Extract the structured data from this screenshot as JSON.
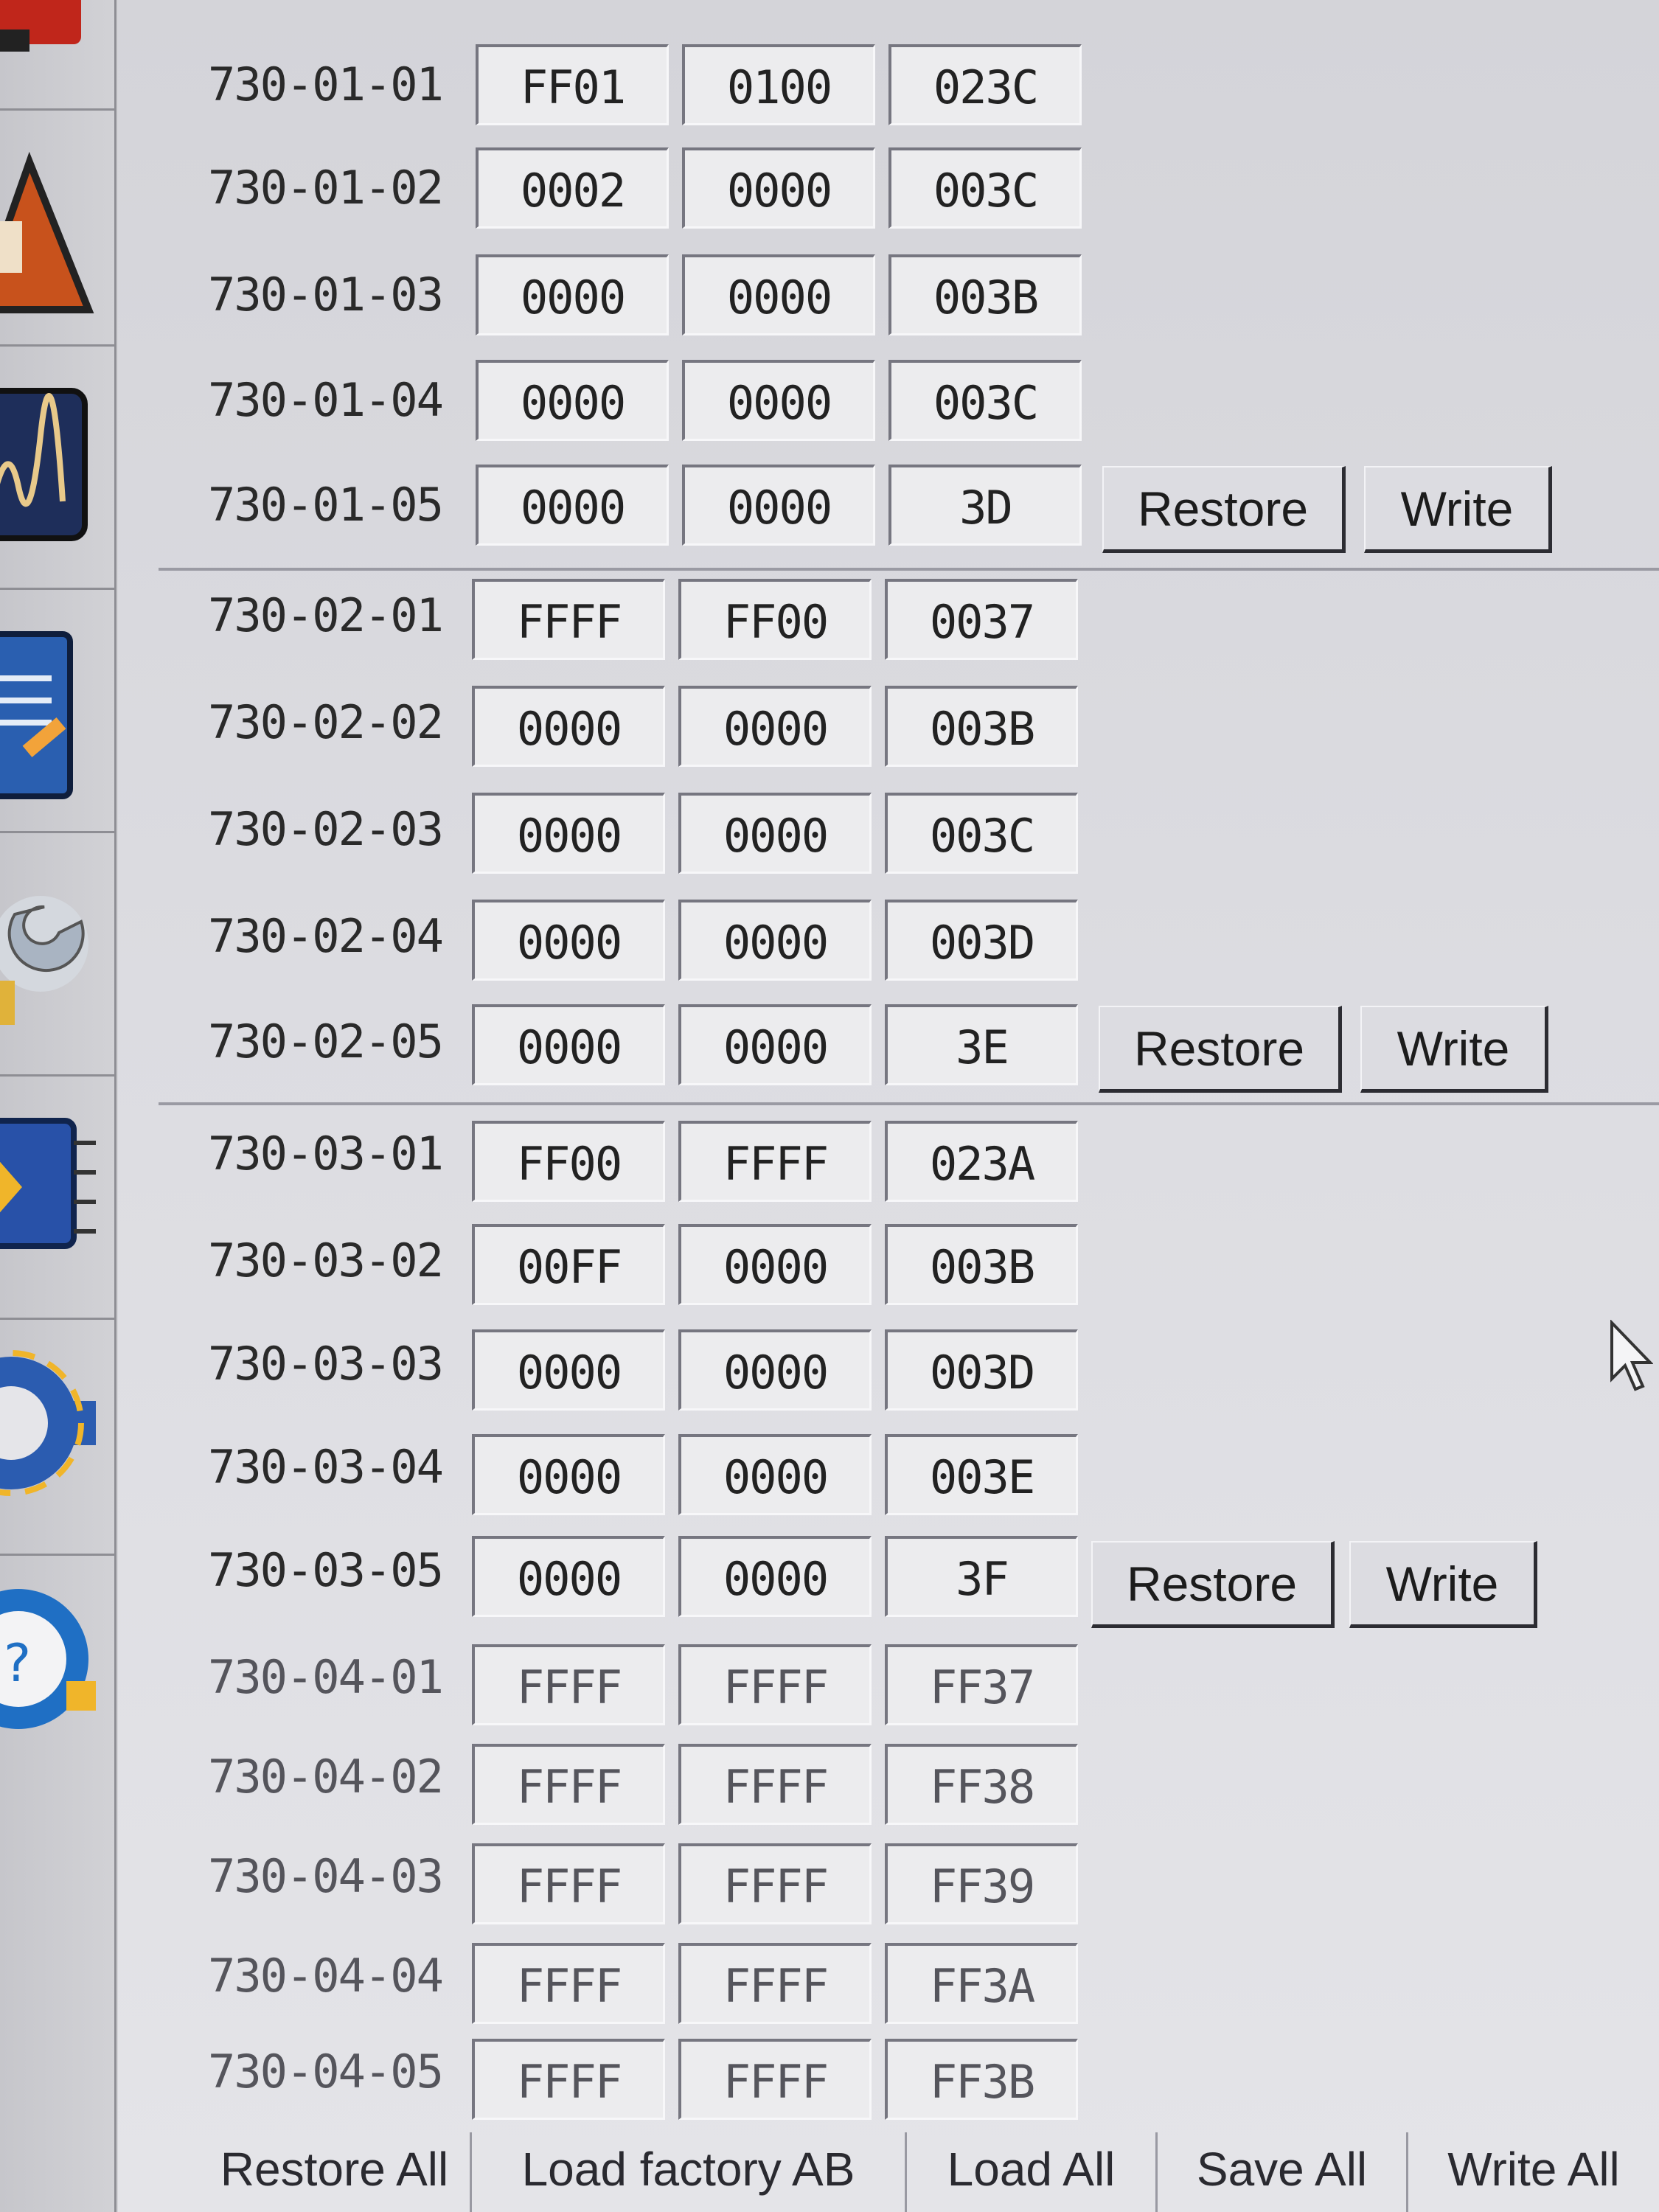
{
  "blocks": [
    {
      "rows": [
        {
          "label": "730-01-01",
          "v1": "FF01",
          "v2": "0100",
          "v3": "023C"
        },
        {
          "label": "730-01-02",
          "v1": "0002",
          "v2": "0000",
          "v3": "003C"
        },
        {
          "label": "730-01-03",
          "v1": "0000",
          "v2": "0000",
          "v3": "003B"
        },
        {
          "label": "730-01-04",
          "v1": "0000",
          "v2": "0000",
          "v3": "003C"
        },
        {
          "label": "730-01-05",
          "v1": "0000",
          "v2": "0000",
          "v3": "3D"
        }
      ],
      "restore_label": "Restore",
      "write_label": "Write"
    },
    {
      "rows": [
        {
          "label": "730-02-01",
          "v1": "FFFF",
          "v2": "FF00",
          "v3": "0037"
        },
        {
          "label": "730-02-02",
          "v1": "0000",
          "v2": "0000",
          "v3": "003B"
        },
        {
          "label": "730-02-03",
          "v1": "0000",
          "v2": "0000",
          "v3": "003C"
        },
        {
          "label": "730-02-04",
          "v1": "0000",
          "v2": "0000",
          "v3": "003D"
        },
        {
          "label": "730-02-05",
          "v1": "0000",
          "v2": "0000",
          "v3": "3E"
        }
      ],
      "restore_label": "Restore",
      "write_label": "Write"
    },
    {
      "rows": [
        {
          "label": "730-03-01",
          "v1": "FF00",
          "v2": "FFFF",
          "v3": "023A"
        },
        {
          "label": "730-03-02",
          "v1": "00FF",
          "v2": "0000",
          "v3": "003B"
        },
        {
          "label": "730-03-03",
          "v1": "0000",
          "v2": "0000",
          "v3": "003D"
        },
        {
          "label": "730-03-04",
          "v1": "0000",
          "v2": "0000",
          "v3": "003E"
        },
        {
          "label": "730-03-05",
          "v1": "0000",
          "v2": "0000",
          "v3": "3F"
        }
      ],
      "restore_label": "Restore",
      "write_label": "Write"
    },
    {
      "rows": [
        {
          "label": "730-04-01",
          "v1": "FFFF",
          "v2": "FFFF",
          "v3": "FF37"
        },
        {
          "label": "730-04-02",
          "v1": "FFFF",
          "v2": "FFFF",
          "v3": "FF38"
        },
        {
          "label": "730-04-03",
          "v1": "FFFF",
          "v2": "FFFF",
          "v3": "FF39"
        },
        {
          "label": "730-04-04",
          "v1": "FFFF",
          "v2": "FFFF",
          "v3": "FF3A"
        },
        {
          "label": "730-04-05",
          "v1": "FFFF",
          "v2": "FFFF",
          "v3": "FF3B"
        }
      ]
    }
  ],
  "bottom_bar": {
    "restore_all": "Restore All",
    "load_factory": "Load factory AB",
    "load_all": "Load All",
    "save_all": "Save All",
    "write_all": "Write All"
  },
  "sidebar_icons": [
    "warning-icon",
    "waveform-icon",
    "notepad-icon",
    "wrench-icon",
    "chip-icon",
    "gear-icon",
    "help-icon"
  ]
}
